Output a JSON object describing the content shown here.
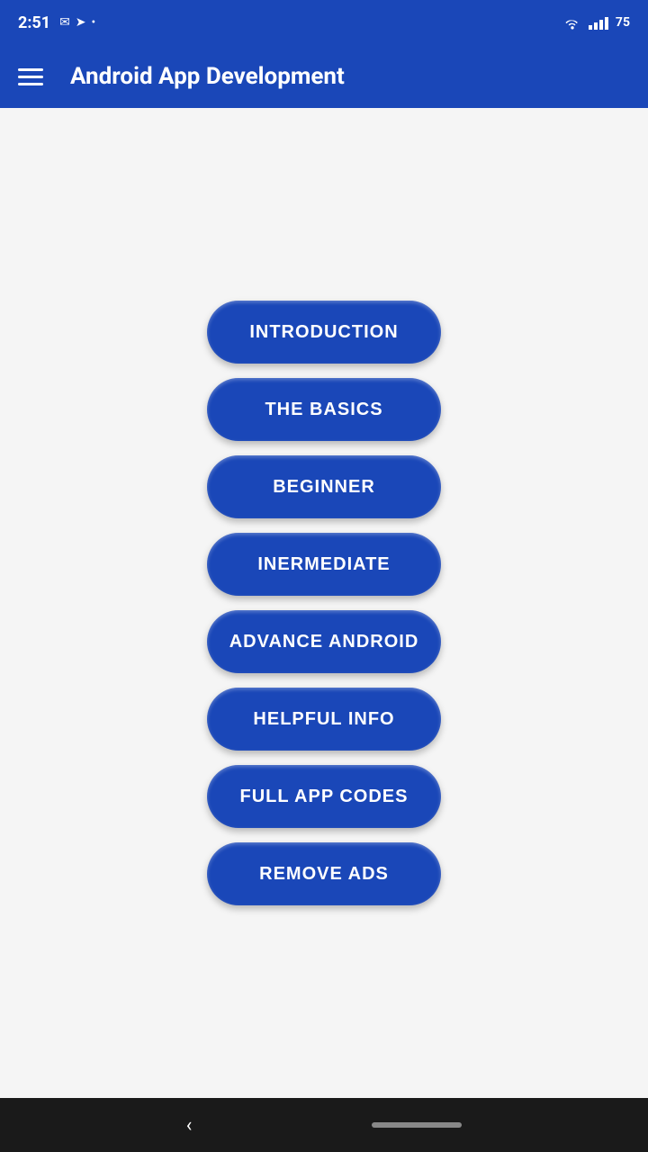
{
  "statusBar": {
    "time": "2:51",
    "batteryLevel": "75",
    "notification_dot": "•"
  },
  "appBar": {
    "title": "Android App Development"
  },
  "menuButtons": [
    {
      "id": "introduction",
      "label": "INTRODUCTION"
    },
    {
      "id": "the-basics",
      "label": "THE BASICS"
    },
    {
      "id": "beginner",
      "label": "BEGINNER"
    },
    {
      "id": "intermediate",
      "label": "INERMEDIATE"
    },
    {
      "id": "advance-android",
      "label": "ADVANCE ANDROID"
    },
    {
      "id": "helpful-info",
      "label": "HELPFUL INFO"
    },
    {
      "id": "full-app-codes",
      "label": "FULL APP CODES"
    },
    {
      "id": "remove-ads",
      "label": "REMOVE ADS"
    }
  ],
  "colors": {
    "appBarBg": "#1a47b8",
    "buttonBg": "#1a47b8",
    "mainBg": "#f5f5f5",
    "navBarBg": "#1a1a1a"
  }
}
